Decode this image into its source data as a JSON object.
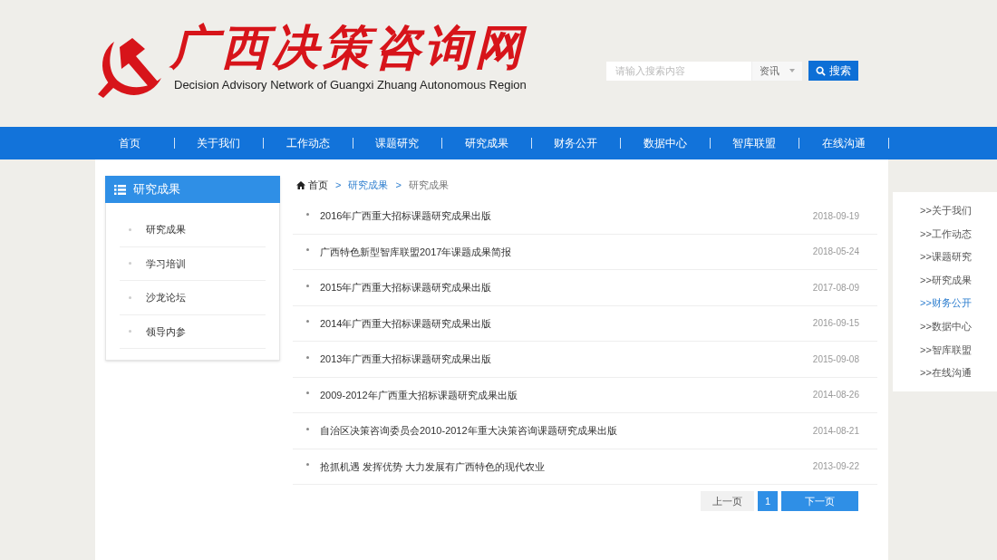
{
  "header": {
    "site_title": "广西决策咨询网",
    "subtitle": "Decision Advisory Network of Guangxi Zhuang Autonomous Region",
    "search": {
      "placeholder": "请输入搜索内容",
      "category": "资讯",
      "button": "搜索"
    }
  },
  "nav": [
    {
      "label": "首页"
    },
    {
      "label": "关于我们"
    },
    {
      "label": "工作动态"
    },
    {
      "label": "课题研究"
    },
    {
      "label": "研究成果"
    },
    {
      "label": "财务公开"
    },
    {
      "label": "数据中心"
    },
    {
      "label": "智库联盟"
    },
    {
      "label": "在线沟通"
    }
  ],
  "sidebar": {
    "title": "研究成果",
    "items": [
      {
        "label": "研究成果"
      },
      {
        "label": "学习培训"
      },
      {
        "label": "沙龙论坛"
      },
      {
        "label": "领导内参"
      }
    ]
  },
  "breadcrumb": [
    {
      "label": "首页",
      "kind": "home"
    },
    {
      "label": "研究成果",
      "kind": "link"
    },
    {
      "label": "研究成果",
      "kind": "current"
    }
  ],
  "breadcrumb_separator": ">",
  "articles": [
    {
      "title": "2016年广西重大招标课题研究成果出版",
      "date": "2018-09-19"
    },
    {
      "title": "广西特色新型智库联盟2017年课题成果简报",
      "date": "2018-05-24"
    },
    {
      "title": "2015年广西重大招标课题研究成果出版",
      "date": "2017-08-09"
    },
    {
      "title": "2014年广西重大招标课题研究成果出版",
      "date": "2016-09-15"
    },
    {
      "title": "2013年广西重大招标课题研究成果出版",
      "date": "2015-09-08"
    },
    {
      "title": "2009-2012年广西重大招标课题研究成果出版",
      "date": "2014-08-26"
    },
    {
      "title": "自治区决策咨询委员会2010-2012年重大决策咨询课题研究成果出版",
      "date": "2014-08-21"
    },
    {
      "title": "抢抓机遇 发挥优势 大力发展有广西特色的现代农业",
      "date": "2013-09-22"
    }
  ],
  "pagination": {
    "prev": "上一页",
    "pages": [
      {
        "label": "1",
        "selected": true
      }
    ],
    "next": "下一页"
  },
  "quick_links": [
    {
      "label": ">>关于我们",
      "selected": false
    },
    {
      "label": ">>工作动态",
      "selected": false
    },
    {
      "label": ">>课题研究",
      "selected": false
    },
    {
      "label": ">>研究成果",
      "selected": false
    },
    {
      "label": ">>财务公开",
      "selected": true
    },
    {
      "label": ">>数据中心",
      "selected": false
    },
    {
      "label": ">>智库联盟",
      "selected": false
    },
    {
      "label": ">>在线沟通",
      "selected": false
    }
  ]
}
